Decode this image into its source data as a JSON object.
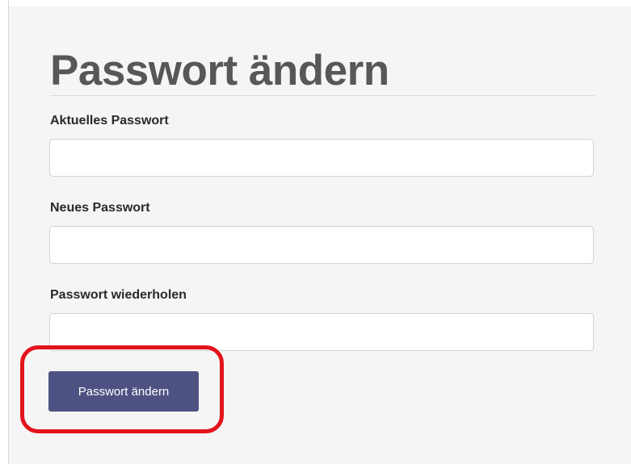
{
  "form": {
    "title": "Passwort ändern",
    "current_password": {
      "label": "Aktuelles Passwort",
      "value": "",
      "placeholder": ""
    },
    "new_password": {
      "label": "Neues Passwort",
      "value": "",
      "placeholder": ""
    },
    "repeat_password": {
      "label": "Passwort wiederholen",
      "value": "",
      "placeholder": ""
    },
    "submit_label": "Passwort ändern"
  },
  "colors": {
    "button_background": "#4e5283",
    "highlight_annotation": "#e3131b",
    "title_text": "#575757",
    "panel_background": "#f5f5f5"
  }
}
